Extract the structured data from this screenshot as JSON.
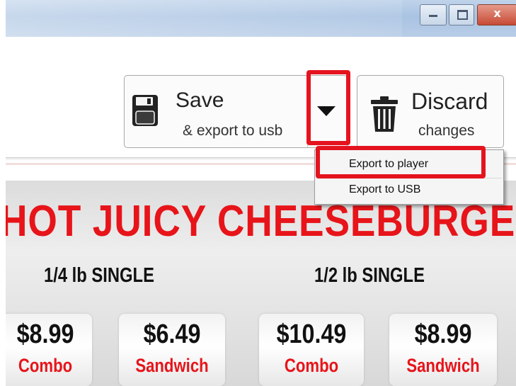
{
  "window": {
    "controls": {
      "minimize_icon": "minimize-icon",
      "maximize_icon": "maximize-icon",
      "close_label": "x"
    }
  },
  "toolbar": {
    "save": {
      "title": "Save",
      "subtitle": "& export to usb",
      "icon": "floppy-disk-icon"
    },
    "dropdown_icon": "caret-down-icon",
    "discard": {
      "title": "Discard",
      "subtitle": "changes",
      "icon": "trash-icon"
    }
  },
  "export_menu": {
    "items": [
      {
        "label": "Export to player",
        "highlighted": true
      },
      {
        "label": "Export to USB",
        "highlighted": false
      }
    ]
  },
  "menu_board": {
    "headline": "HOT JUICY CHEESEBURGER",
    "sections": [
      "1/4 lb SINGLE",
      "1/2 lb SINGLE"
    ],
    "prices": [
      {
        "price": "$8.99",
        "label": "Combo"
      },
      {
        "price": "$6.49",
        "label": "Sandwich"
      },
      {
        "price": "$10.49",
        "label": "Combo"
      },
      {
        "price": "$8.99",
        "label": "Sandwich"
      }
    ]
  },
  "colors": {
    "highlight": "#e4141f",
    "headline_red": "#e7141a",
    "titlebar": "#b8cde7"
  }
}
